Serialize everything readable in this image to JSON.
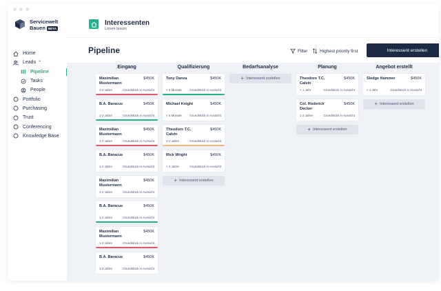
{
  "app": {
    "brand_line1": "Servicewelt",
    "brand_line2": "Bauen",
    "beta_label": "BETA"
  },
  "sidebar": {
    "items": [
      {
        "label": "Home",
        "icon": "home-icon"
      },
      {
        "label": "Leads",
        "icon": "users-icon"
      },
      {
        "label": "Pipeline",
        "icon": "pipeline-icon"
      },
      {
        "label": "Tasks",
        "icon": "check-circle-icon"
      },
      {
        "label": "People",
        "icon": "person-icon"
      },
      {
        "label": "Portfolio",
        "icon": "circle-icon"
      },
      {
        "label": "Purchasing",
        "icon": "circle-icon"
      },
      {
        "label": "Trust",
        "icon": "circle-icon"
      },
      {
        "label": "Conferencing",
        "icon": "circle-icon"
      },
      {
        "label": "Knowledge Base",
        "icon": "circle-icon"
      }
    ]
  },
  "header": {
    "title": "Interessenten",
    "subtitle": "Lorem ipsum"
  },
  "toolbar": {
    "page_title": "Pipeline",
    "filter_label": "Filter",
    "sort_label": "Highest priority first",
    "create_label": "Interessent erstellen"
  },
  "colors": {
    "accent": "#23b08a",
    "primary": "#1e2a44",
    "danger": "#e2566b",
    "warning": "#f2b47a"
  },
  "add_label": "Interessent erstellen",
  "columns": [
    {
      "title": "Eingang",
      "cards": [
        {
          "name": "Maximilian Mustermann",
          "amount": "$450K",
          "duration": "1-2 Jahre",
          "status": "Grundstück in Aussicht",
          "accent": "red"
        },
        {
          "name": "B.A. Baracus",
          "amount": "$450K",
          "duration": "1-2 Jahre",
          "status": "Grundstück in Aussicht",
          "accent": "green"
        },
        {
          "name": "Maximilian Mustermann",
          "amount": "$450K",
          "duration": "1-2 Jahre",
          "status": "Grundstück in Aussicht",
          "accent": "red"
        },
        {
          "name": "B.A. Baracus",
          "amount": "$450K",
          "duration": "1-2 Jahre",
          "status": "Grundstück in Aussicht",
          "accent": "none"
        },
        {
          "name": "Maximilian Mustermann",
          "amount": "$450K",
          "duration": "1-2 Jahre",
          "status": "Grundstück in Aussicht",
          "accent": "none"
        },
        {
          "name": "B.A. Baracus",
          "amount": "$450K",
          "duration": "1-2 Jahre",
          "status": "Grundstück in Aussicht",
          "accent": "green"
        },
        {
          "name": "Maximilian Mustermann",
          "amount": "$450K",
          "duration": "1-2 Jahre",
          "status": "Grundstück in Aussicht",
          "accent": "red"
        },
        {
          "name": "B.A. Baracus",
          "amount": "$450K",
          "duration": "1-2 Jahre",
          "status": "Grundstück in Aussicht",
          "accent": "none"
        }
      ],
      "show_add": false
    },
    {
      "title": "Qualifizierung",
      "cards": [
        {
          "name": "Tony Danza",
          "amount": "$450K",
          "duration": "< 6 Monate",
          "status": "Grundstück in Aussicht",
          "accent": "green"
        },
        {
          "name": "Michael Knight",
          "amount": "$450K",
          "duration": "< 6 Monate",
          "status": "Grundstück in Aussicht",
          "accent": "none"
        },
        {
          "name": "Theodore T.C. Calvin",
          "amount": "$450K",
          "duration": "1-2 Jahre",
          "status": "Grundstück in Aussicht",
          "accent": "orange"
        },
        {
          "name": "Rick Wright",
          "amount": "$450K",
          "duration": "> 2 Jahre",
          "status": "Grundstück in Aussicht",
          "accent": "none"
        }
      ],
      "show_add": true
    },
    {
      "title": "Bedarfsanalyse",
      "cards": [],
      "show_add": true
    },
    {
      "title": "Planung",
      "cards": [
        {
          "name": "Theodore T.C. Calvin",
          "amount": "$450K",
          "duration": "< 1 Jahr",
          "status": "Grundstück in Aussicht",
          "accent": "none"
        },
        {
          "name": "Col. Roderick Decker",
          "amount": "$450K",
          "duration": "1-2 Jahre",
          "status": "Grundstück in Aussicht",
          "accent": "none"
        }
      ],
      "show_add": true
    },
    {
      "title": "Angebot erstellt",
      "cards": [
        {
          "name": "Sledge Hammer",
          "amount": "$450K",
          "duration": "< 1 Jahr",
          "status": "Grundstück in Aussicht",
          "accent": "none"
        }
      ],
      "show_add": true
    }
  ]
}
